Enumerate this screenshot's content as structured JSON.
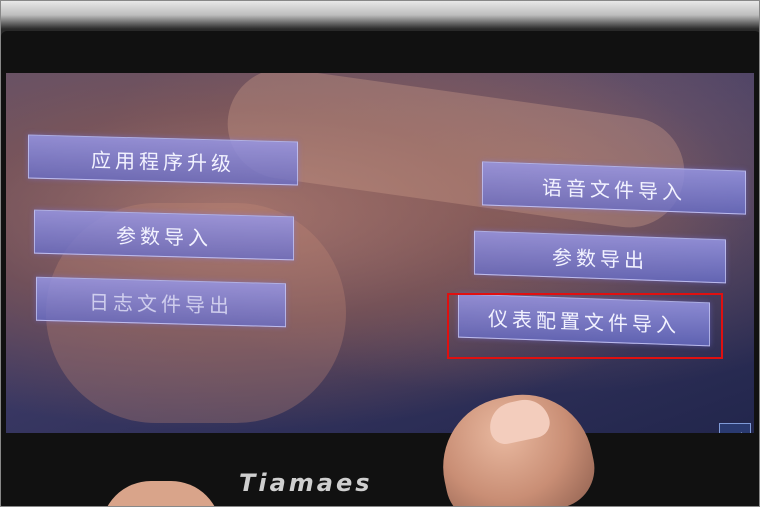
{
  "device": {
    "brand": "Tiamaes"
  },
  "menu": {
    "left": [
      {
        "label": "应用程序升级"
      },
      {
        "label": "参数导入"
      },
      {
        "label": "日志文件导出"
      }
    ],
    "right": [
      {
        "label": "语音文件导入"
      },
      {
        "label": "参数导出"
      },
      {
        "label": "仪表配置文件导入"
      }
    ]
  },
  "nav": {
    "back_glyph": "◀"
  },
  "annotation": {
    "highlight_color": "#e01010"
  }
}
